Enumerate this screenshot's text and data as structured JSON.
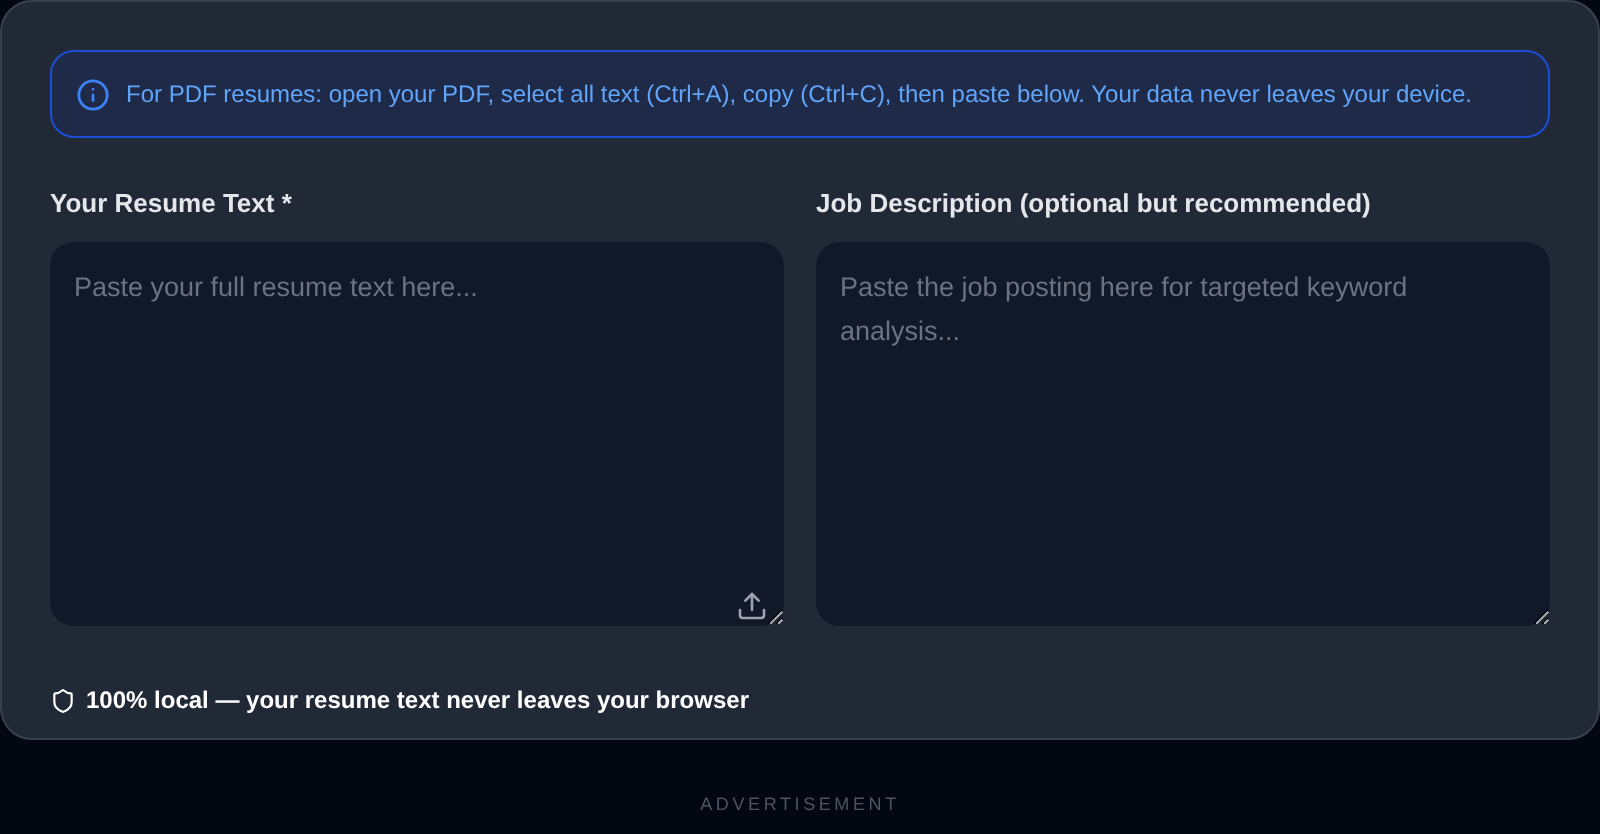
{
  "notice": {
    "text": "For PDF resumes: open your PDF, select all text (Ctrl+A), copy (Ctrl+C), then paste below. Your data never leaves your device."
  },
  "fields": [
    {
      "label": "Your Resume Text *",
      "placeholder": "Paste your full resume text here...",
      "upload": true
    },
    {
      "label": "Job Description (optional but recommended)",
      "placeholder": "Paste the job posting here for targeted keyword analysis...",
      "upload": false
    }
  ],
  "privacy_note": "100% local — your resume text never leaves your browser",
  "ad_label": "ADVERTISEMENT"
}
